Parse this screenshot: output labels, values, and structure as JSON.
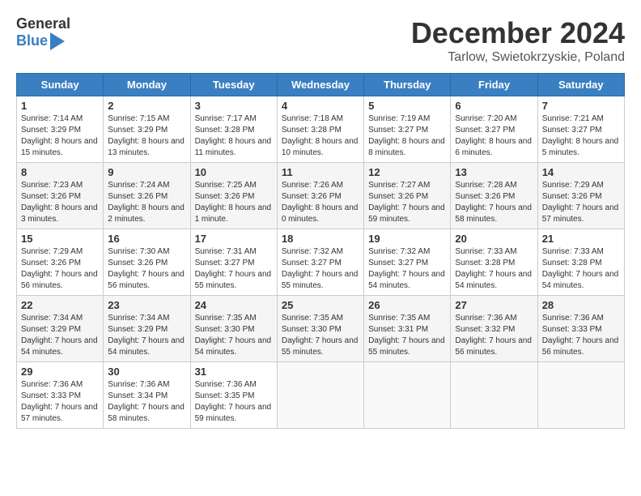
{
  "header": {
    "logo_general": "General",
    "logo_blue": "Blue",
    "title": "December 2024",
    "subtitle": "Tarlow, Swietokrzyskie, Poland"
  },
  "weekdays": [
    "Sunday",
    "Monday",
    "Tuesday",
    "Wednesday",
    "Thursday",
    "Friday",
    "Saturday"
  ],
  "weeks": [
    [
      {
        "day": "1",
        "sunrise": "7:14 AM",
        "sunset": "3:29 PM",
        "daylight": "8 hours and 15 minutes."
      },
      {
        "day": "2",
        "sunrise": "7:15 AM",
        "sunset": "3:29 PM",
        "daylight": "8 hours and 13 minutes."
      },
      {
        "day": "3",
        "sunrise": "7:17 AM",
        "sunset": "3:28 PM",
        "daylight": "8 hours and 11 minutes."
      },
      {
        "day": "4",
        "sunrise": "7:18 AM",
        "sunset": "3:28 PM",
        "daylight": "8 hours and 10 minutes."
      },
      {
        "day": "5",
        "sunrise": "7:19 AM",
        "sunset": "3:27 PM",
        "daylight": "8 hours and 8 minutes."
      },
      {
        "day": "6",
        "sunrise": "7:20 AM",
        "sunset": "3:27 PM",
        "daylight": "8 hours and 6 minutes."
      },
      {
        "day": "7",
        "sunrise": "7:21 AM",
        "sunset": "3:27 PM",
        "daylight": "8 hours and 5 minutes."
      }
    ],
    [
      {
        "day": "8",
        "sunrise": "7:23 AM",
        "sunset": "3:26 PM",
        "daylight": "8 hours and 3 minutes."
      },
      {
        "day": "9",
        "sunrise": "7:24 AM",
        "sunset": "3:26 PM",
        "daylight": "8 hours and 2 minutes."
      },
      {
        "day": "10",
        "sunrise": "7:25 AM",
        "sunset": "3:26 PM",
        "daylight": "8 hours and 1 minute."
      },
      {
        "day": "11",
        "sunrise": "7:26 AM",
        "sunset": "3:26 PM",
        "daylight": "8 hours and 0 minutes."
      },
      {
        "day": "12",
        "sunrise": "7:27 AM",
        "sunset": "3:26 PM",
        "daylight": "7 hours and 59 minutes."
      },
      {
        "day": "13",
        "sunrise": "7:28 AM",
        "sunset": "3:26 PM",
        "daylight": "7 hours and 58 minutes."
      },
      {
        "day": "14",
        "sunrise": "7:29 AM",
        "sunset": "3:26 PM",
        "daylight": "7 hours and 57 minutes."
      }
    ],
    [
      {
        "day": "15",
        "sunrise": "7:29 AM",
        "sunset": "3:26 PM",
        "daylight": "7 hours and 56 minutes."
      },
      {
        "day": "16",
        "sunrise": "7:30 AM",
        "sunset": "3:26 PM",
        "daylight": "7 hours and 56 minutes."
      },
      {
        "day": "17",
        "sunrise": "7:31 AM",
        "sunset": "3:27 PM",
        "daylight": "7 hours and 55 minutes."
      },
      {
        "day": "18",
        "sunrise": "7:32 AM",
        "sunset": "3:27 PM",
        "daylight": "7 hours and 55 minutes."
      },
      {
        "day": "19",
        "sunrise": "7:32 AM",
        "sunset": "3:27 PM",
        "daylight": "7 hours and 54 minutes."
      },
      {
        "day": "20",
        "sunrise": "7:33 AM",
        "sunset": "3:28 PM",
        "daylight": "7 hours and 54 minutes."
      },
      {
        "day": "21",
        "sunrise": "7:33 AM",
        "sunset": "3:28 PM",
        "daylight": "7 hours and 54 minutes."
      }
    ],
    [
      {
        "day": "22",
        "sunrise": "7:34 AM",
        "sunset": "3:29 PM",
        "daylight": "7 hours and 54 minutes."
      },
      {
        "day": "23",
        "sunrise": "7:34 AM",
        "sunset": "3:29 PM",
        "daylight": "7 hours and 54 minutes."
      },
      {
        "day": "24",
        "sunrise": "7:35 AM",
        "sunset": "3:30 PM",
        "daylight": "7 hours and 54 minutes."
      },
      {
        "day": "25",
        "sunrise": "7:35 AM",
        "sunset": "3:30 PM",
        "daylight": "7 hours and 55 minutes."
      },
      {
        "day": "26",
        "sunrise": "7:35 AM",
        "sunset": "3:31 PM",
        "daylight": "7 hours and 55 minutes."
      },
      {
        "day": "27",
        "sunrise": "7:36 AM",
        "sunset": "3:32 PM",
        "daylight": "7 hours and 56 minutes."
      },
      {
        "day": "28",
        "sunrise": "7:36 AM",
        "sunset": "3:33 PM",
        "daylight": "7 hours and 56 minutes."
      }
    ],
    [
      {
        "day": "29",
        "sunrise": "7:36 AM",
        "sunset": "3:33 PM",
        "daylight": "7 hours and 57 minutes."
      },
      {
        "day": "30",
        "sunrise": "7:36 AM",
        "sunset": "3:34 PM",
        "daylight": "7 hours and 58 minutes."
      },
      {
        "day": "31",
        "sunrise": "7:36 AM",
        "sunset": "3:35 PM",
        "daylight": "7 hours and 59 minutes."
      },
      null,
      null,
      null,
      null
    ]
  ]
}
